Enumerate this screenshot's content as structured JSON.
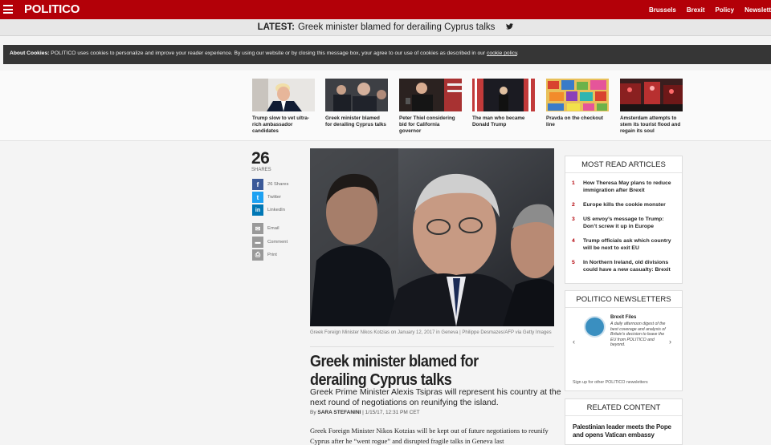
{
  "header": {
    "logo": "POLITICO",
    "nav": [
      "Brussels",
      "Brexit",
      "Policy",
      "Newslett"
    ]
  },
  "latest": {
    "label": "LATEST:",
    "text": "Greek minister blamed for derailing Cyprus talks",
    "icon": "twitter-icon"
  },
  "cookie": {
    "label": "About Cookies:",
    "text": " POLITICO uses cookies to personalize and improve your reader experience. By using our website or by closing this message box, your agree to our use of cookies as described in our ",
    "link": "cookie policy",
    "end": "."
  },
  "strip": [
    {
      "title": "Trump slow to vet ultra-rich ambassador candidates"
    },
    {
      "title": "Greek minister blamed for derailing Cyprus talks"
    },
    {
      "title": "Peter Thiel considering bid for California governor"
    },
    {
      "title": "The man who became Donald Trump"
    },
    {
      "title": "Pravda on the checkout line"
    },
    {
      "title": "Amsterdam attempts to stem its tourist flood and regain its soul"
    }
  ],
  "share": {
    "count": "26",
    "label": "SHARES",
    "items": [
      {
        "label": "26 Shares",
        "icon": "facebook-icon",
        "color": "#3b5998",
        "glyph": "f"
      },
      {
        "label": "Twitter",
        "icon": "twitter-icon",
        "color": "#1da1f2",
        "glyph": "t"
      },
      {
        "label": "LinkedIn",
        "icon": "linkedin-icon",
        "color": "#0077b5",
        "glyph": "in"
      },
      {
        "label": "Email",
        "icon": "email-icon",
        "color": "#999999",
        "glyph": "✉"
      },
      {
        "label": "Comment",
        "icon": "comment-icon",
        "color": "#999999",
        "glyph": "💬"
      },
      {
        "label": "Print",
        "icon": "print-icon",
        "color": "#999999",
        "glyph": "⎙"
      }
    ]
  },
  "article": {
    "caption": "Greek Foreign Minister Nikos Kotzias on January 12, 2017 in Geneva | Philippe Desmazes/AFP via Getty Images",
    "headline": "Greek minister blamed for derailing Cyprus talks",
    "dek": "Greek Prime Minister Alexis Tsipras will represent his country at the next round of negotiations on reunifying the island.",
    "by": "By ",
    "author": "SARA STEFANINI",
    "date": " | 1/15/17, 12:31 PM CET",
    "body": "Greek Foreign Minister Nikos Kotzias will be kept out of future negotiations to reunify Cyprus after he “went rogue” and disrupted fragile talks in Geneva last"
  },
  "most_read": {
    "title": "MOST READ ARTICLES",
    "items": [
      {
        "num": "1",
        "text": "How Theresa May plans to reduce immigration after Brexit"
      },
      {
        "num": "2",
        "text": "Europe kills the cookie monster"
      },
      {
        "num": "3",
        "text": "US envoy’s message to Trump: Don’t screw it up in Europe"
      },
      {
        "num": "4",
        "text": "Trump officials ask which country will be next to exit EU"
      },
      {
        "num": "5",
        "text": "In Northern Ireland, old divisions could have a new casualty: Brexit"
      }
    ]
  },
  "newsletters": {
    "title": "POLITICO NEWSLETTERS",
    "name": "Brexit Files",
    "desc": "A daily afternoon digest of the best coverage and analysis of Britain’s decision to leave the EU from POLITICO and beyond.",
    "footer": "Sign up for other POLITICO newsletters"
  },
  "related": {
    "title": "RELATED CONTENT",
    "item": "Palestinian leader meets the Pope and opens Vatican embassy"
  }
}
